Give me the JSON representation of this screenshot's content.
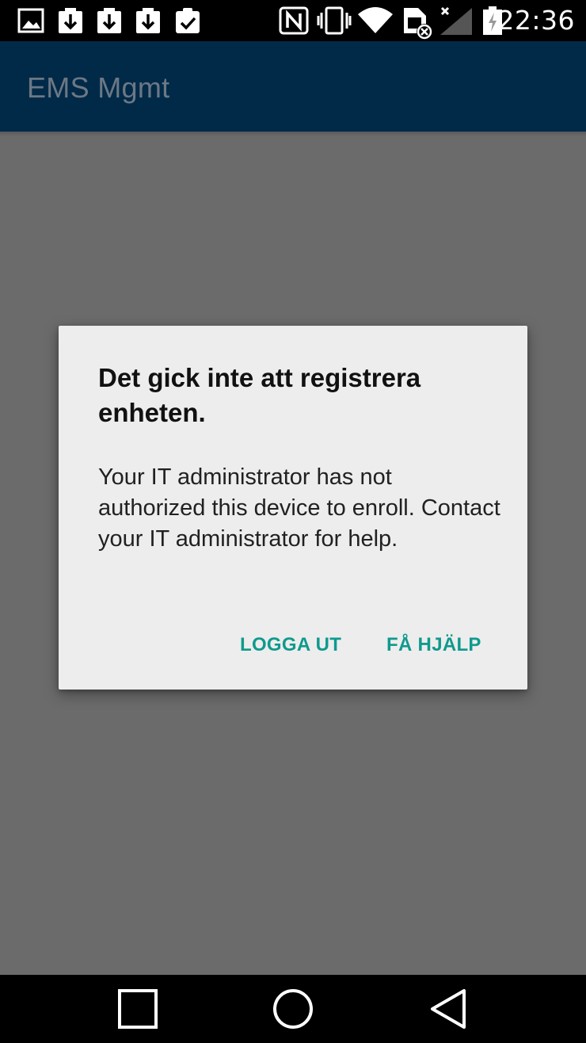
{
  "status_bar": {
    "time": "22:36",
    "icons": [
      "image-icon",
      "download-icon",
      "download-icon",
      "download-icon",
      "clipboard-check-icon",
      "nfc-icon",
      "vibrate-icon",
      "wifi-icon",
      "sim-no-signal-icon",
      "signal-off-icon",
      "battery-charging-icon"
    ]
  },
  "app_bar": {
    "title": "EMS Mgmt"
  },
  "dialog": {
    "title": "Det gick inte att registrera enheten.",
    "message": "Your IT administrator has not authorized this device to enroll. Contact your IT administrator for help.",
    "buttons": {
      "logout": "LOGGA UT",
      "help": "FÅ HJÄLP"
    },
    "accent_color": "#0f9a8d"
  },
  "nav_bar": {
    "buttons": [
      "recents-icon",
      "home-icon",
      "back-icon"
    ]
  },
  "colors": {
    "app_bar": "#012a48",
    "scrim": "#6b6b6b",
    "dialog_bg": "#ededed"
  }
}
